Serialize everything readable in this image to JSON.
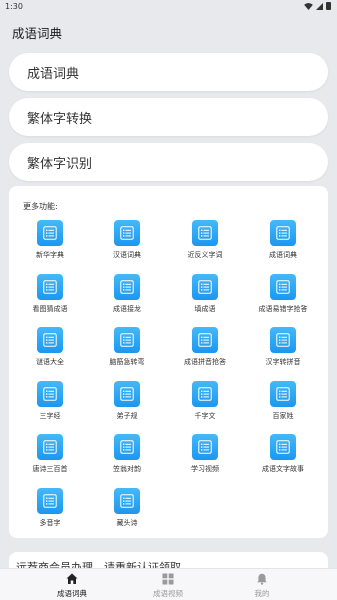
{
  "status_bar": {
    "time": "1:30"
  },
  "app_bar": {
    "title": "成语词典"
  },
  "main_buttons": [
    {
      "label": "成语词典"
    },
    {
      "label": "繁体字转换"
    },
    {
      "label": "繁体字识别"
    }
  ],
  "more_features": {
    "title": "更多功能:",
    "items": [
      {
        "label": "新华字典"
      },
      {
        "label": "汉语词典"
      },
      {
        "label": "近反义字词"
      },
      {
        "label": "成语词典"
      },
      {
        "label": "看图猜成语"
      },
      {
        "label": "成语接龙"
      },
      {
        "label": "填成语"
      },
      {
        "label": "成语易错字抢答"
      },
      {
        "label": "谜语大全"
      },
      {
        "label": "脑筋急转弯"
      },
      {
        "label": "成语拼音抢答"
      },
      {
        "label": "汉字转拼音"
      },
      {
        "label": "三字经"
      },
      {
        "label": "弟子规"
      },
      {
        "label": "千字文"
      },
      {
        "label": "百家姓"
      },
      {
        "label": "唐诗三百首"
      },
      {
        "label": "笠翁对韵"
      },
      {
        "label": "学习视频"
      },
      {
        "label": "成语文字故事"
      },
      {
        "label": "多音字"
      },
      {
        "label": "藏头诗"
      }
    ],
    "icon_name": "list-doc-icon",
    "icon_color": "#2aa5f5"
  },
  "notice": {
    "text": "远荐商会员办理，请重新认证领取"
  },
  "bottom_nav": {
    "items": [
      {
        "label": "成语词典",
        "icon": "home-icon",
        "active": true
      },
      {
        "label": "成语视频",
        "icon": "grid-icon",
        "active": false
      },
      {
        "label": "我的",
        "icon": "bell-icon",
        "active": false
      }
    ]
  }
}
